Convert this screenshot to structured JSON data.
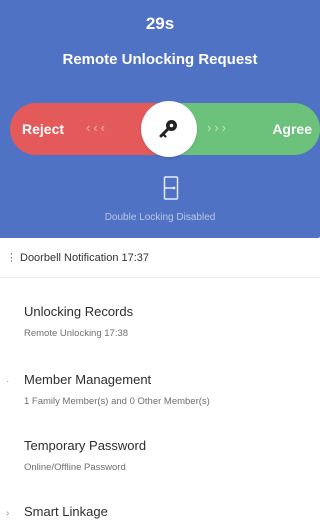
{
  "request_panel": {
    "countdown": "29s",
    "title": "Remote Unlocking Request",
    "reject_label": "Reject",
    "agree_label": "Agree",
    "reject_arrows": "‹‹‹",
    "agree_arrows": "›››",
    "lock_status": "Double Locking Disabled",
    "colors": {
      "panel": "#4f72c4",
      "reject": "#e45a5a",
      "agree": "#6cc27a"
    },
    "icons": {
      "knob": "key-icon",
      "status": "door-unlocked-icon"
    }
  },
  "doorbell": {
    "text": "Doorbell Notification 17:37"
  },
  "menu": {
    "items": [
      {
        "title": "Unlocking Records",
        "subtitle": "Remote Unlocking 17:38"
      },
      {
        "title": "Member Management",
        "subtitle": "1 Family Member(s) and 0 Other Member(s)"
      },
      {
        "title": "Temporary Password",
        "subtitle": "Online/Offline Password"
      },
      {
        "title": "Smart Linkage",
        "subtitle": ""
      }
    ]
  }
}
